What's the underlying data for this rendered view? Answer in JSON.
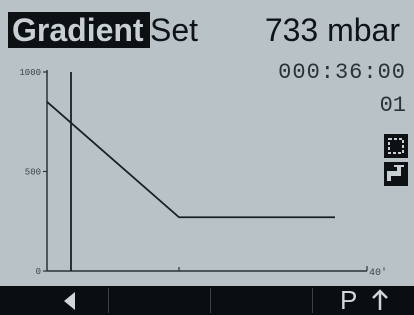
{
  "header": {
    "mode": "Gradient",
    "submode": "Set",
    "pressure": "733 mbar"
  },
  "status": {
    "timer": "000:36:00",
    "step": "01"
  },
  "side_icons": [
    {
      "name": "expand-icon"
    },
    {
      "name": "faucet-icon"
    }
  ],
  "chart_data": {
    "type": "line",
    "y_ticks": [
      "1000",
      "500",
      "0"
    ],
    "x_end_label": "40'",
    "ylim": [
      0,
      1000
    ],
    "xlim": [
      0,
      40
    ],
    "series": [
      {
        "x": [
          0,
          16.5,
          36
        ],
        "y": [
          850,
          270,
          270
        ]
      }
    ],
    "marker_x": 3
  },
  "softkeys": {
    "back_icon": "left-arrow-icon",
    "pump_label": "P",
    "up_icon": "up-arrow-icon"
  },
  "colors": {
    "background": "#b9c3c7",
    "text_dark": "#101418",
    "bar_dark": "#0d1114"
  }
}
